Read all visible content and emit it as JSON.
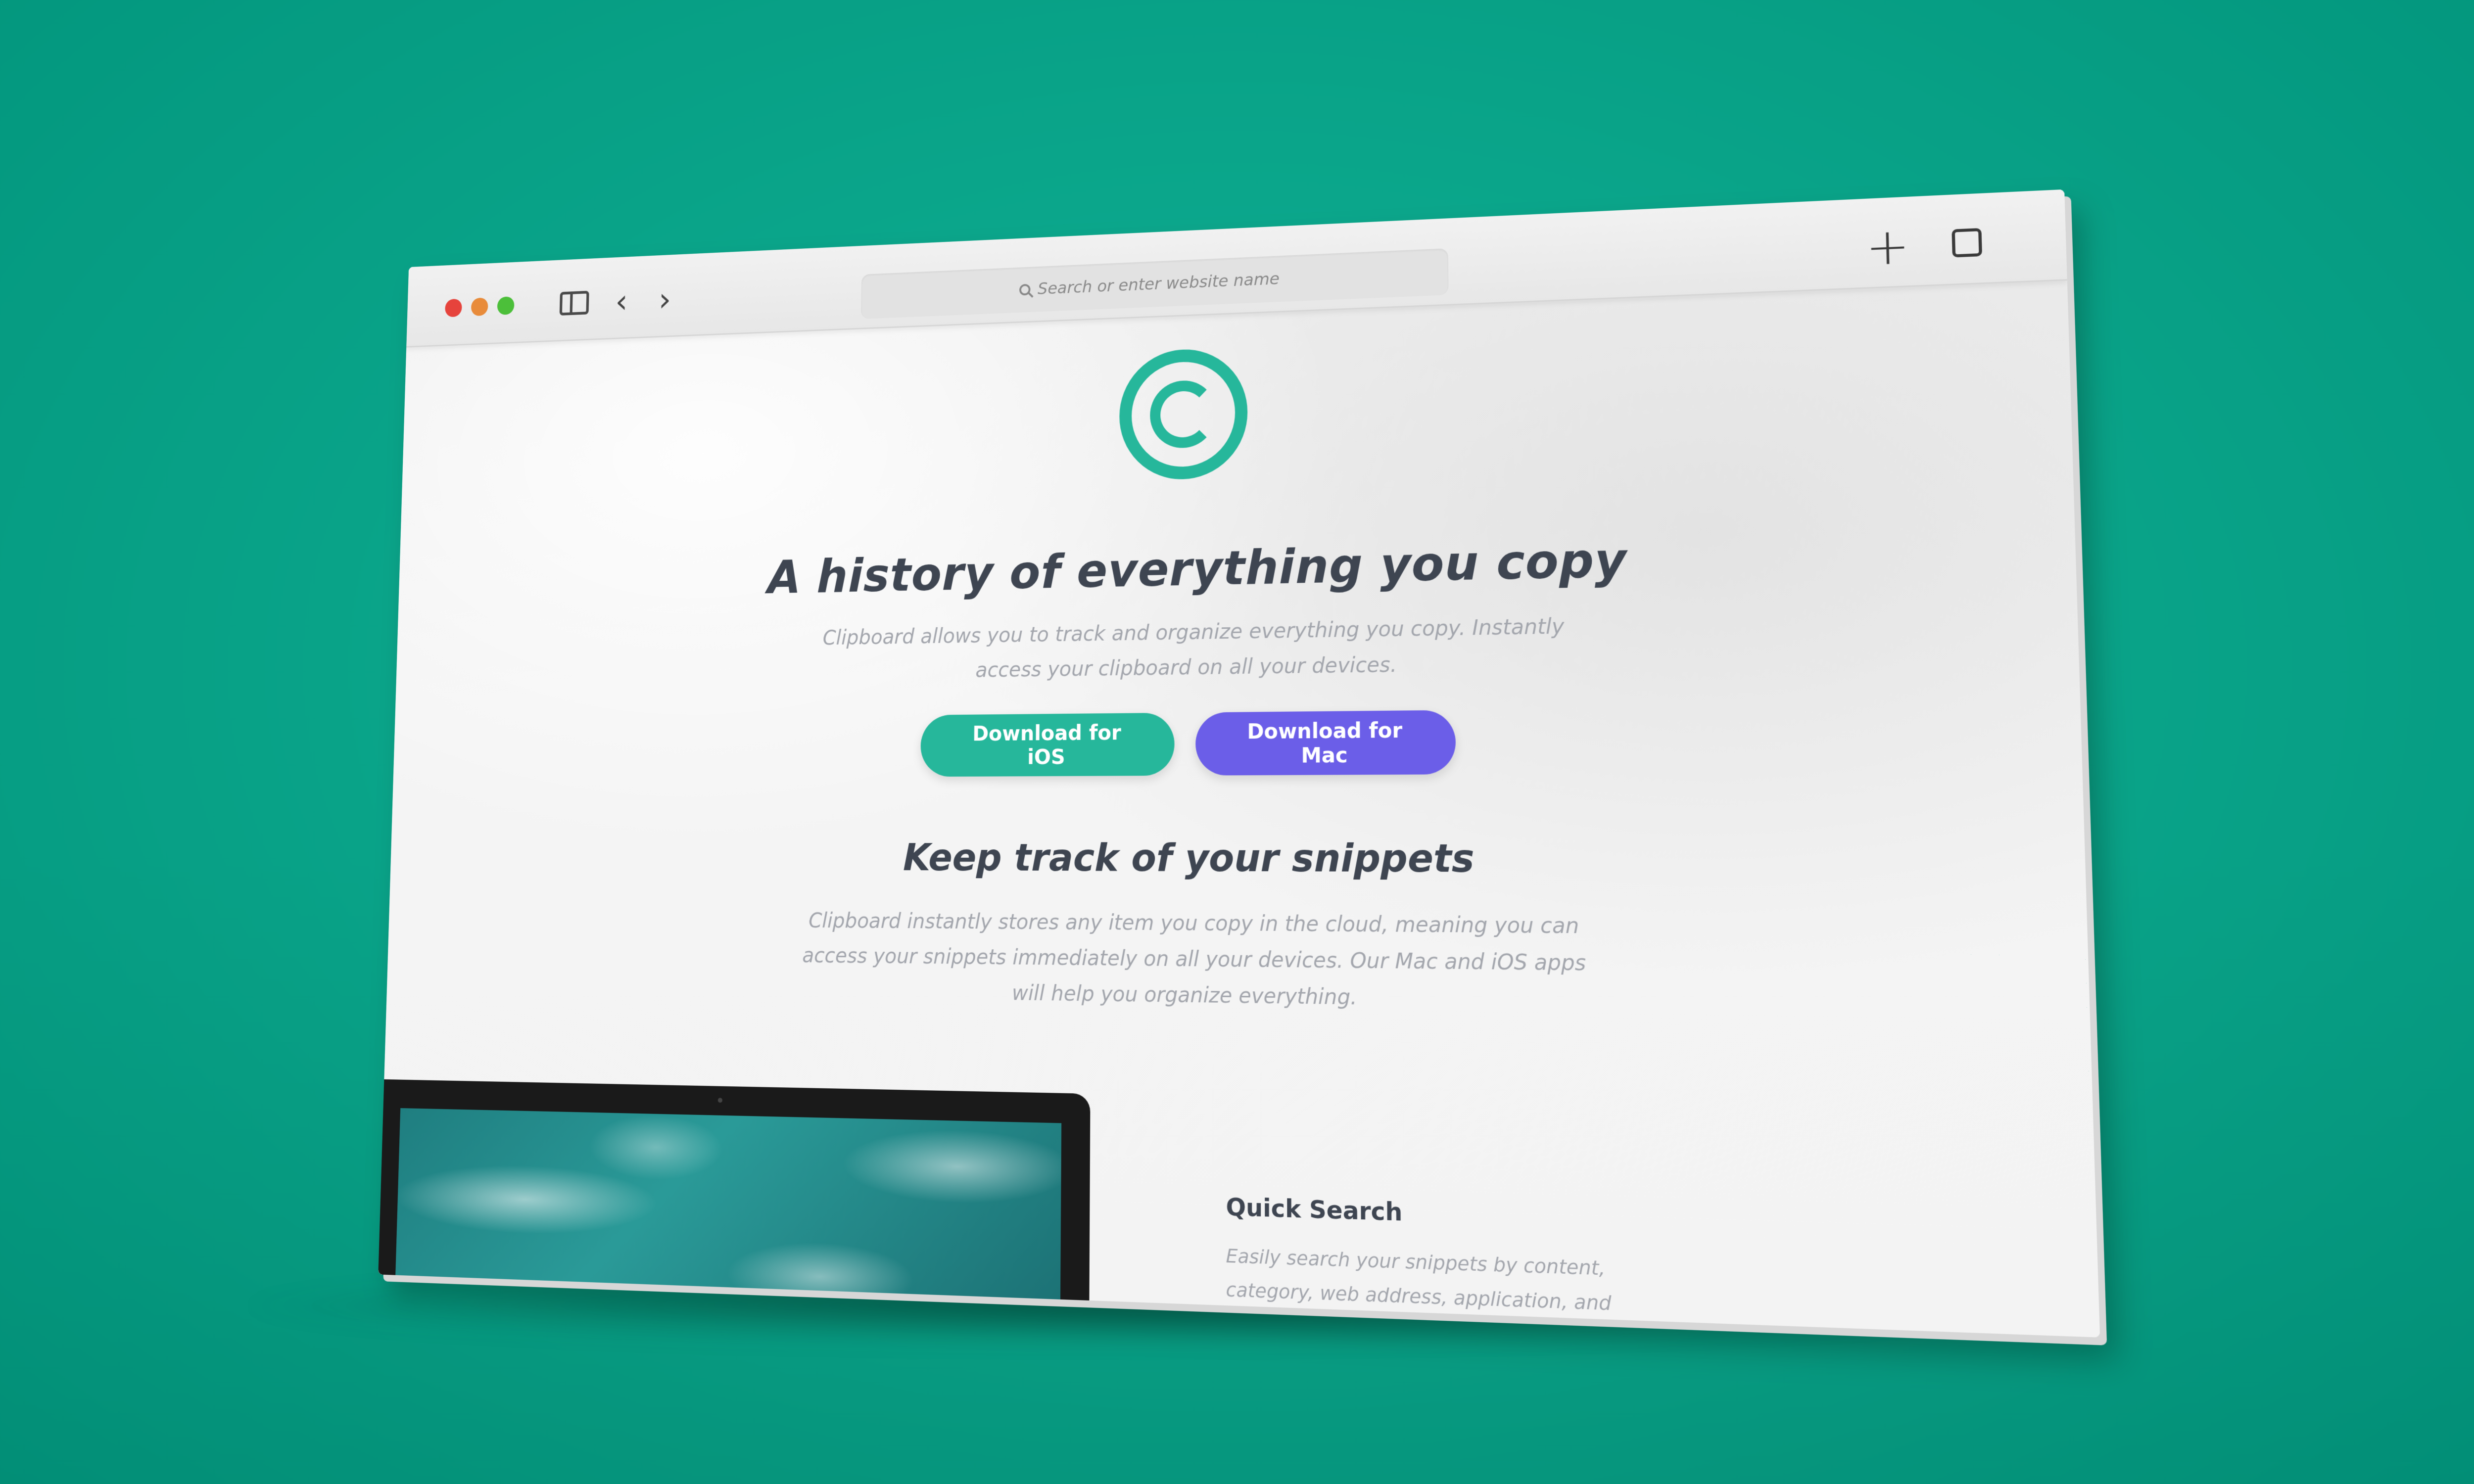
{
  "browser": {
    "address_placeholder": "Search or enter website name",
    "icons": {
      "close": "close-dot",
      "minimize": "minimize-dot",
      "zoom": "zoom-dot",
      "sidebar": "sidebar-icon",
      "back": "chevron-left-icon",
      "forward": "chevron-right-icon",
      "search": "search-icon",
      "new_tab": "plus-icon",
      "tabs": "tabs-icon"
    },
    "colors": {
      "close": "#e6433c",
      "minimize": "#e88b3a",
      "zoom": "#4cbf3a"
    }
  },
  "hero": {
    "title": "A history of everything you copy",
    "description": "Clipboard allows you to track and organize everything you copy. Instantly access your clipboard on all your devices.",
    "buttons": {
      "ios": "Download for iOS",
      "mac": "Download for Mac"
    }
  },
  "snippets": {
    "title": "Keep track of your snippets",
    "description": "Clipboard instantly stores any item you copy in the cloud, meaning you can access your snippets immediately on all your devices. Our Mac and iOS apps will help you organize everything."
  },
  "feature": {
    "title": "Quick Search",
    "description": "Easily search your snippets by content, category, web address, application, and more."
  },
  "colors": {
    "background": "#0aa58a",
    "accent": "#26b79b",
    "mac_button": "#6b5ee8",
    "heading": "#3e4551",
    "body_text": "#a3a6ad"
  }
}
